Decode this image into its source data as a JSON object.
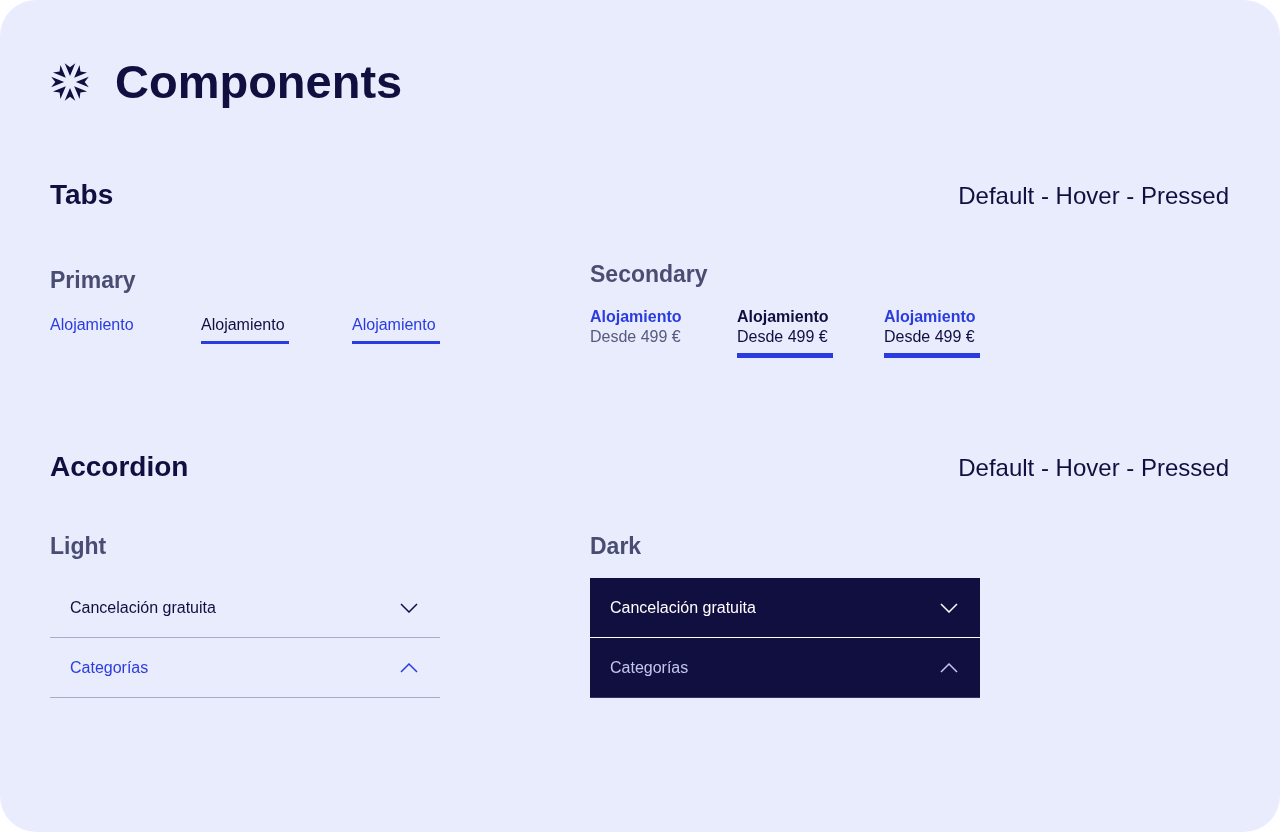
{
  "header": {
    "title": "Components"
  },
  "sections": [
    {
      "kind": "tabs",
      "title": "Tabs",
      "caption": "Default - Hover - Pressed",
      "groups": [
        {
          "kind": "primary",
          "title": "Primary",
          "tabs": [
            {
              "label": "Alojamiento",
              "selected": false,
              "hovered": false
            },
            {
              "label": "Alojamiento",
              "selected": true,
              "hovered": true
            },
            {
              "label": "Alojamiento",
              "selected": true,
              "hovered": false
            }
          ]
        },
        {
          "kind": "secondary",
          "title": "Secondary",
          "tabs": [
            {
              "label": "Alojamiento",
              "sublabel": "Desde 499 €",
              "selected": false,
              "hovered": false
            },
            {
              "label": "Alojamiento",
              "sublabel": "Desde 499 €",
              "selected": true,
              "hovered": true
            },
            {
              "label": "Alojamiento",
              "sublabel": "Desde 499 €",
              "selected": true,
              "hovered": false
            }
          ]
        }
      ]
    },
    {
      "kind": "accordion",
      "title": "Accordion",
      "caption": "Default - Hover - Pressed",
      "groups": [
        {
          "kind": "light",
          "title": "Light",
          "items": [
            {
              "label": "Cancelación gratuita",
              "expanded": false
            },
            {
              "label": "Categorías",
              "expanded": true
            }
          ]
        },
        {
          "kind": "dark",
          "title": "Dark",
          "items": [
            {
              "label": "Cancelación gratuita",
              "expanded": false
            },
            {
              "label": "Categorías",
              "expanded": true
            }
          ]
        }
      ]
    }
  ]
}
